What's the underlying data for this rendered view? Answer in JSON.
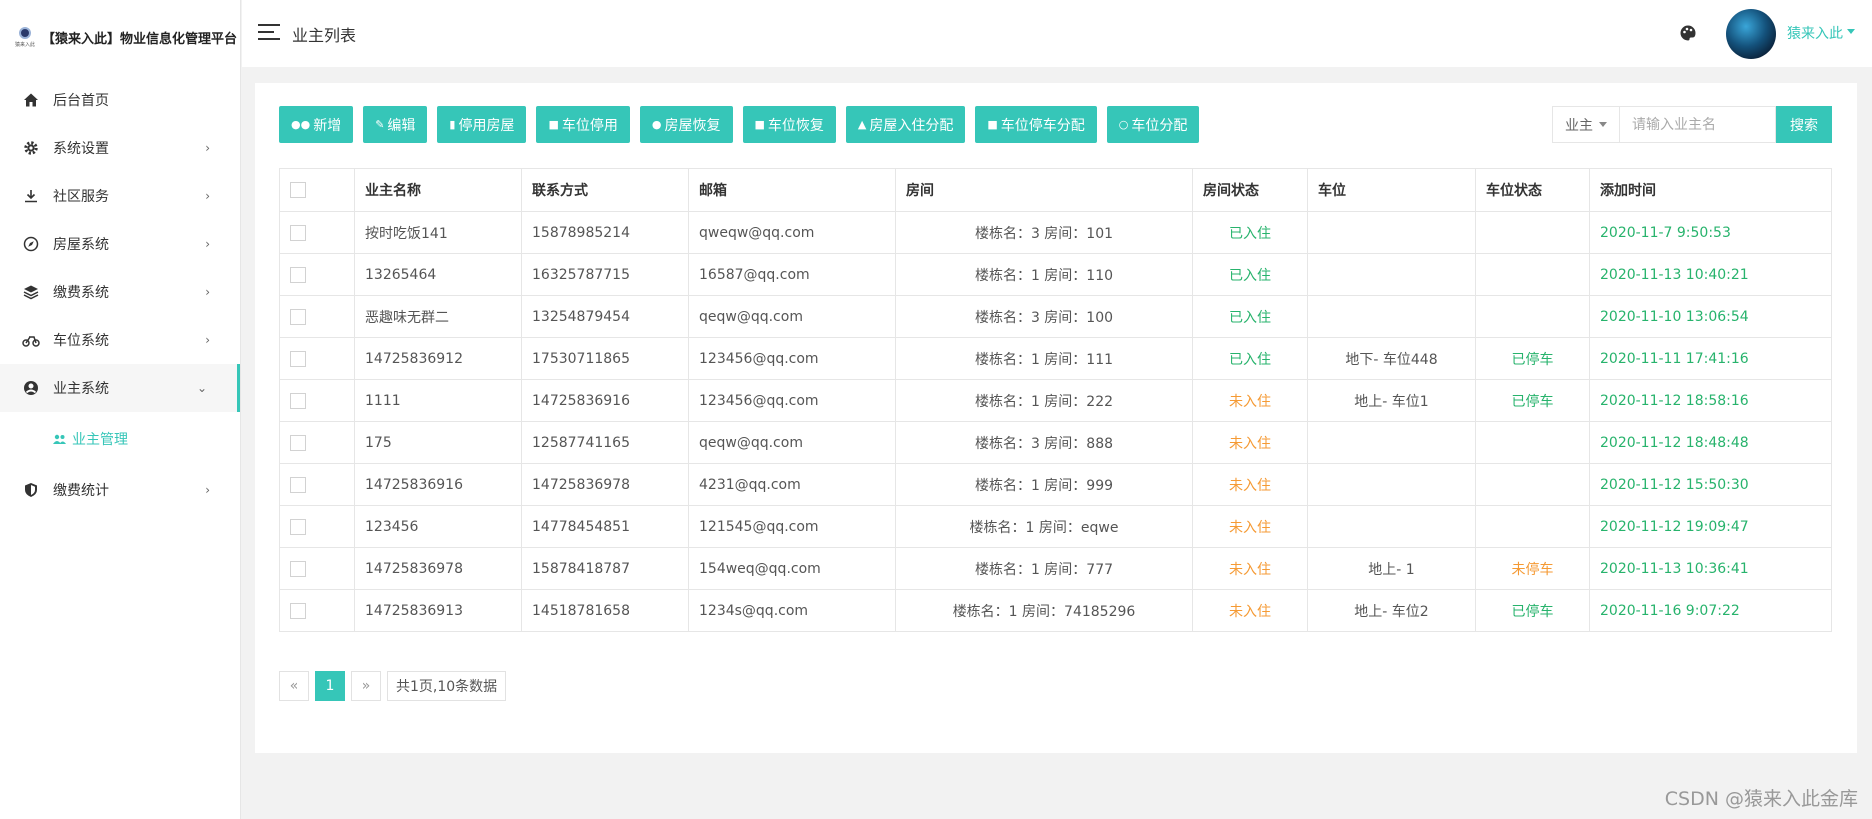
{
  "brand": {
    "logo_text": "猿来入此",
    "name": "【猿来入此】物业信息化管理平台"
  },
  "sidebar": {
    "items": [
      {
        "label": "后台首页",
        "icon": "home-icon",
        "chevron": ""
      },
      {
        "label": "系统设置",
        "icon": "gear-icon",
        "chevron": "›"
      },
      {
        "label": "社区服务",
        "icon": "download-icon",
        "chevron": "›"
      },
      {
        "label": "房屋系统",
        "icon": "compass-icon",
        "chevron": "›"
      },
      {
        "label": "缴费系统",
        "icon": "layers-icon",
        "chevron": "›"
      },
      {
        "label": "车位系统",
        "icon": "bike-icon",
        "chevron": "›"
      },
      {
        "label": "业主系统",
        "icon": "user-circle-icon",
        "chevron": "⌄"
      },
      {
        "label": "缴费统计",
        "icon": "shield-icon",
        "chevron": "›"
      }
    ],
    "sub_item": {
      "label": "业主管理",
      "icon": "users-icon"
    }
  },
  "header": {
    "title": "业主列表",
    "user_name": "猿来入此"
  },
  "toolbar": {
    "buttons": [
      {
        "label": "新增",
        "icon": "users-icon"
      },
      {
        "label": "编辑",
        "icon": "pencil-icon"
      },
      {
        "label": "停用房屋",
        "icon": "bed-icon"
      },
      {
        "label": "车位停用",
        "icon": "truck-icon"
      },
      {
        "label": "房屋恢复",
        "icon": "user-icon"
      },
      {
        "label": "车位恢复",
        "icon": "bus-icon"
      },
      {
        "label": "房屋入住分配",
        "icon": "user-tie-icon"
      },
      {
        "label": "车位停车分配",
        "icon": "car-icon"
      },
      {
        "label": "车位分配",
        "icon": "user-outline-icon"
      }
    ]
  },
  "search": {
    "select_label": "业主",
    "placeholder": "请输入业主名",
    "button_label": "搜索"
  },
  "table": {
    "columns": [
      "业主名称",
      "联系方式",
      "邮箱",
      "房间",
      "房间状态",
      "车位",
      "车位状态",
      "添加时间"
    ],
    "rows": [
      {
        "name": "按时吃饭141",
        "phone": "15878985214",
        "email": "qweqw@qq.com",
        "room": "楼栋名：3 房间：101",
        "room_status": "已入住",
        "room_status_type": "green",
        "parking": "",
        "parking_status": "",
        "parking_status_type": "",
        "time": "2020-11-7 9:50:53"
      },
      {
        "name": "13265464",
        "phone": "16325787715",
        "email": "16587@qq.com",
        "room": "楼栋名：1 房间：110",
        "room_status": "已入住",
        "room_status_type": "green",
        "parking": "",
        "parking_status": "",
        "parking_status_type": "",
        "time": "2020-11-13 10:40:21"
      },
      {
        "name": "恶趣味无群二",
        "phone": "13254879454",
        "email": "qeqw@qq.com",
        "room": "楼栋名：3 房间：100",
        "room_status": "已入住",
        "room_status_type": "green",
        "parking": "",
        "parking_status": "",
        "parking_status_type": "",
        "time": "2020-11-10 13:06:54"
      },
      {
        "name": "14725836912",
        "phone": "17530711865",
        "email": "123456@qq.com",
        "room": "楼栋名：1 房间：111",
        "room_status": "已入住",
        "room_status_type": "green",
        "parking": "地下- 车位448",
        "parking_status": "已停车",
        "parking_status_type": "green",
        "time": "2020-11-11 17:41:16"
      },
      {
        "name": "1111",
        "phone": "14725836916",
        "email": "123456@qq.com",
        "room": "楼栋名：1 房间：222",
        "room_status": "未入住",
        "room_status_type": "orange",
        "parking": "地上- 车位1",
        "parking_status": "已停车",
        "parking_status_type": "green",
        "time": "2020-11-12 18:58:16"
      },
      {
        "name": "175",
        "phone": "12587741165",
        "email": "qeqw@qq.com",
        "room": "楼栋名：3 房间：888",
        "room_status": "未入住",
        "room_status_type": "orange",
        "parking": "",
        "parking_status": "",
        "parking_status_type": "",
        "time": "2020-11-12 18:48:48"
      },
      {
        "name": "14725836916",
        "phone": "14725836978",
        "email": "4231@qq.com",
        "room": "楼栋名：1 房间：999",
        "room_status": "未入住",
        "room_status_type": "orange",
        "parking": "",
        "parking_status": "",
        "parking_status_type": "",
        "time": "2020-11-12 15:50:30"
      },
      {
        "name": "123456",
        "phone": "14778454851",
        "email": "121545@qq.com",
        "room": "楼栋名：1 房间：eqwe",
        "room_status": "未入住",
        "room_status_type": "orange",
        "parking": "",
        "parking_status": "",
        "parking_status_type": "",
        "time": "2020-11-12 19:09:47"
      },
      {
        "name": "14725836978",
        "phone": "15878418787",
        "email": "154weq@qq.com",
        "room": "楼栋名：1 房间：777",
        "room_status": "未入住",
        "room_status_type": "orange",
        "parking": "地上- 1",
        "parking_status": "未停车",
        "parking_status_type": "orange",
        "time": "2020-11-13 10:36:41"
      },
      {
        "name": "14725836913",
        "phone": "14518781658",
        "email": "1234s@qq.com",
        "room": "楼栋名：1 房间：74185296",
        "room_status": "未入住",
        "room_status_type": "orange",
        "parking": "地上- 车位2",
        "parking_status": "已停车",
        "parking_status_type": "green",
        "time": "2020-11-16 9:07:22"
      }
    ]
  },
  "pagination": {
    "prev": "«",
    "current": "1",
    "next": "»",
    "info": "共1页,10条数据"
  },
  "watermark": "CSDN @猿来入此金库",
  "colors": {
    "accent": "#36c6b8",
    "status_green": "#27b36c",
    "status_orange": "#f59a34"
  }
}
